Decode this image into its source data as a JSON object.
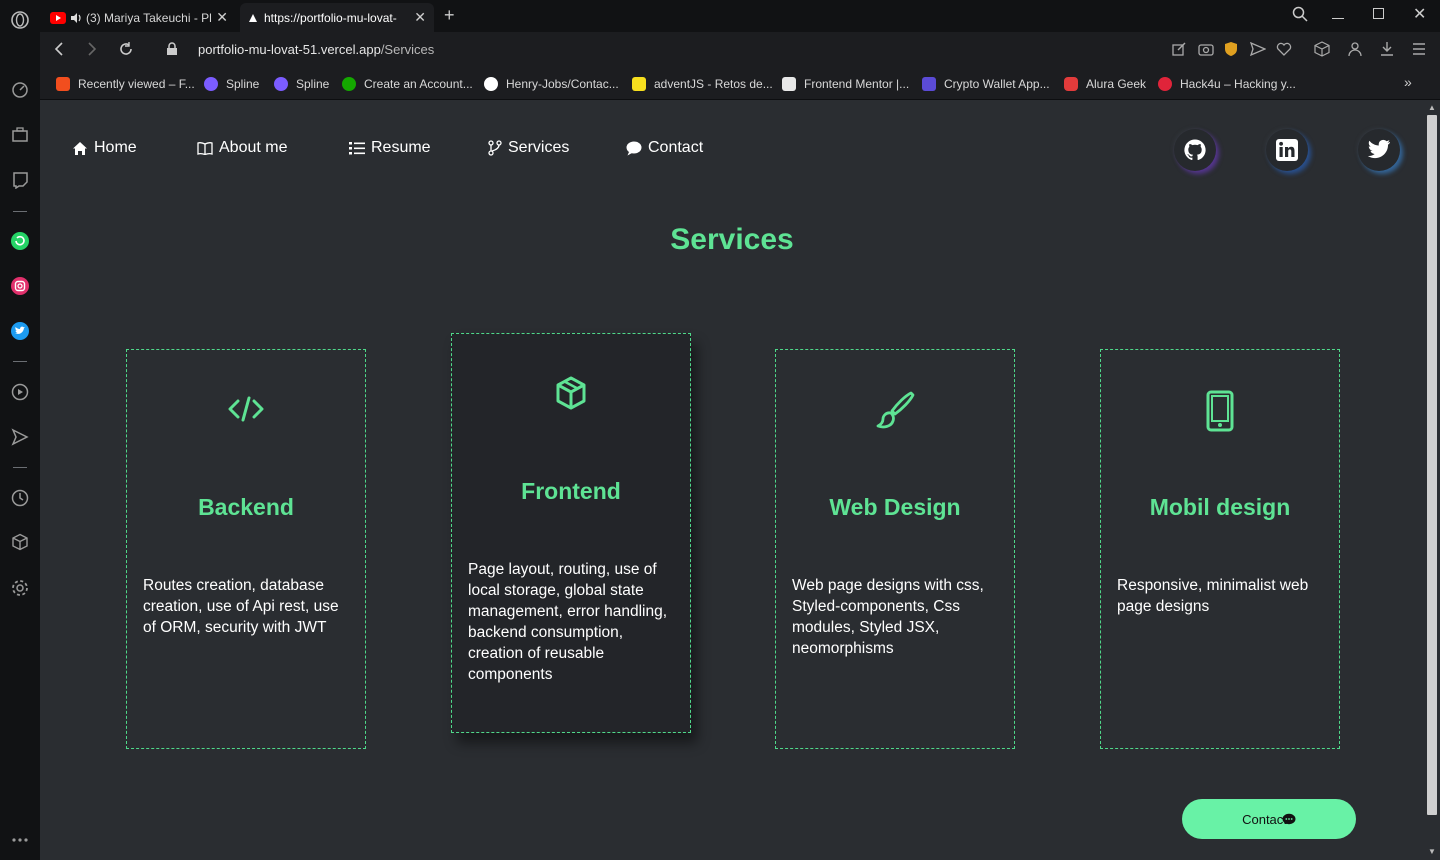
{
  "browser": {
    "tabs": [
      {
        "label": "(3) Mariya Takeuchi - Pl"
      },
      {
        "label": "https://portfolio-mu-lovat-"
      }
    ],
    "url_domain": "portfolio-mu-lovat-51.vercel.app",
    "url_path": "/Services",
    "bookmarks": [
      {
        "label": "Recently viewed – F...",
        "color": "#f24e1e"
      },
      {
        "label": "Spline",
        "color": "#7b5cff"
      },
      {
        "label": "Spline",
        "color": "#7b5cff"
      },
      {
        "label": "Create an Account...",
        "color": "#14a800"
      },
      {
        "label": "Henry-Jobs/Contac...",
        "color": "#ffffff"
      },
      {
        "label": "adventJS - Retos de...",
        "color": "#f7df1e"
      },
      {
        "label": "Frontend Mentor |...",
        "color": "#e8e8e8"
      },
      {
        "label": "Crypto Wallet App...",
        "color": "#5b4bd6"
      },
      {
        "label": "Alura Geek",
        "color": "#e23b3b"
      },
      {
        "label": "Hack4u – Hacking y...",
        "color": "#e0243a"
      }
    ]
  },
  "nav": {
    "home": "Home",
    "about": "About me",
    "resume": "Resume",
    "services": "Services",
    "contact": "Contact"
  },
  "page_title": "Services",
  "cards": [
    {
      "icon": "code-icon",
      "title": "Backend",
      "text": "Routes creation, database creation, use of Api rest, use of ORM, security with JWT"
    },
    {
      "icon": "cube-icon",
      "title": "Frontend",
      "text": "Page layout, routing, use of local storage, global state management, error handling, backend consumption, creation of reusable components"
    },
    {
      "icon": "brush-icon",
      "title": "Web Design",
      "text": "Web page designs with css, Styled-components, Css modules, Styled JSX, neomorphisms"
    },
    {
      "icon": "phone-icon",
      "title": "Mobil design",
      "text": "Responsive, minimalist web page designs"
    }
  ],
  "contact_button": "Contact",
  "colors": {
    "accent": "#5ee394",
    "button": "#68f2a6",
    "background": "#2a2d31"
  }
}
